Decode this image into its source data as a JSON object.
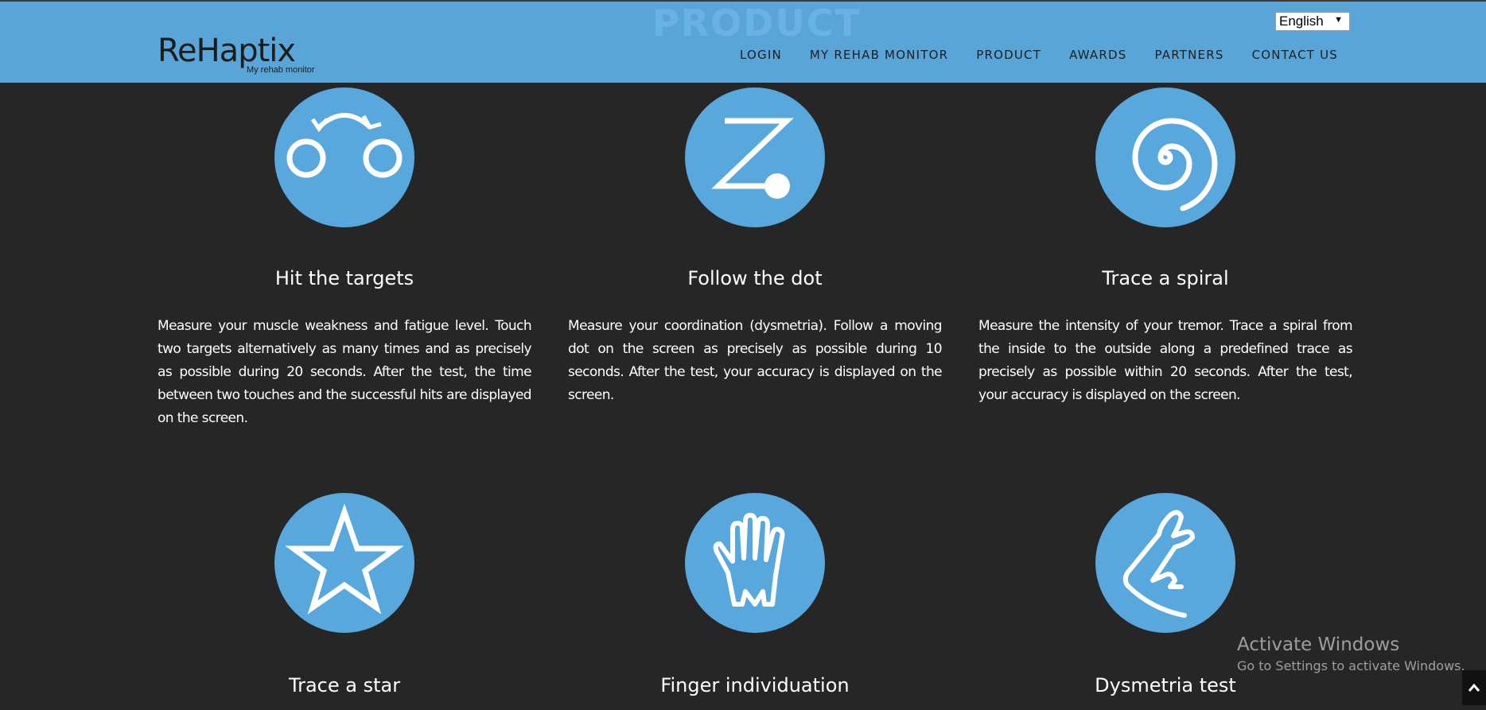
{
  "header": {
    "bg_title": "PRODUCT",
    "logo_text": "ReHaptix",
    "logo_sub": "My rehab monitor",
    "nav": [
      "LOGIN",
      "MY REHAB MONITOR",
      "PRODUCT",
      "AWARDS",
      "PARTNERS",
      "CONTACT US"
    ],
    "language": "English"
  },
  "features": [
    {
      "icon": "targets-icon",
      "title": "Hit the targets",
      "desc": "Measure your muscle weakness and fatigue level. Touch two targets alternatively as many times and as precisely as possible during 20 seconds. After the test, the time between two touches and the successful hits are displayed on the screen."
    },
    {
      "icon": "follow-dot-icon",
      "title": "Follow the dot",
      "desc": "Measure your coordination (dysmetria). Follow a moving dot on the screen as precisely as possible during 10 seconds. After the test, your accuracy is displayed on the screen."
    },
    {
      "icon": "spiral-icon",
      "title": "Trace a spiral",
      "desc": "Measure the intensity of your tremor. Trace a spiral from the inside to the outside along a predefined trace as precisely as possible within 20 seconds. After the test, your accuracy is displayed on the screen."
    },
    {
      "icon": "star-icon",
      "title": "Trace a star"
    },
    {
      "icon": "hand-icon",
      "title": "Finger individuation"
    },
    {
      "icon": "pointing-arm-icon",
      "title": "Dysmetria test"
    }
  ],
  "activate_windows": {
    "title": "Activate Windows",
    "subtitle": "Go to Settings to activate Windows."
  },
  "colors": {
    "header": "#5aa5d8",
    "background": "#262626",
    "circle": "#58a8dd"
  }
}
